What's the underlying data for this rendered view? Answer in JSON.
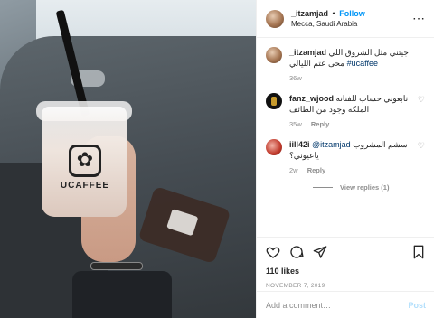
{
  "photo": {
    "brand_text": "UCAFFEE"
  },
  "header": {
    "username": "_itzamjad",
    "separator": "•",
    "follow_label": "Follow",
    "location": "Mecca, Saudi Arabia",
    "more_icon": "more-horizontal-icon"
  },
  "caption": {
    "username": "_itzamjad",
    "text": "جيتني مثل الشروق اللي محى عتم الليالي",
    "hashtag": "#ucaffee",
    "age": "36w"
  },
  "comments": [
    {
      "username": "fanz_wjood",
      "text": "تابعوني حساب للفنانه الملكة وجود من الطائف",
      "age": "35w",
      "reply_label": "Reply"
    },
    {
      "username": "iill42i",
      "mention": "@itzamjad",
      "text": "سشم المشروب ياعيوني؟",
      "age": "2w",
      "reply_label": "Reply",
      "view_replies": "View replies (1)"
    }
  ],
  "actions": {
    "likes": "110 likes",
    "date": "NOVEMBER 7, 2019"
  },
  "add_comment": {
    "placeholder": "Add a comment…",
    "post_label": "Post"
  },
  "colors": {
    "accent": "#0095f6",
    "muted": "#8e8e8e",
    "post_disabled": "#b2dffc"
  }
}
